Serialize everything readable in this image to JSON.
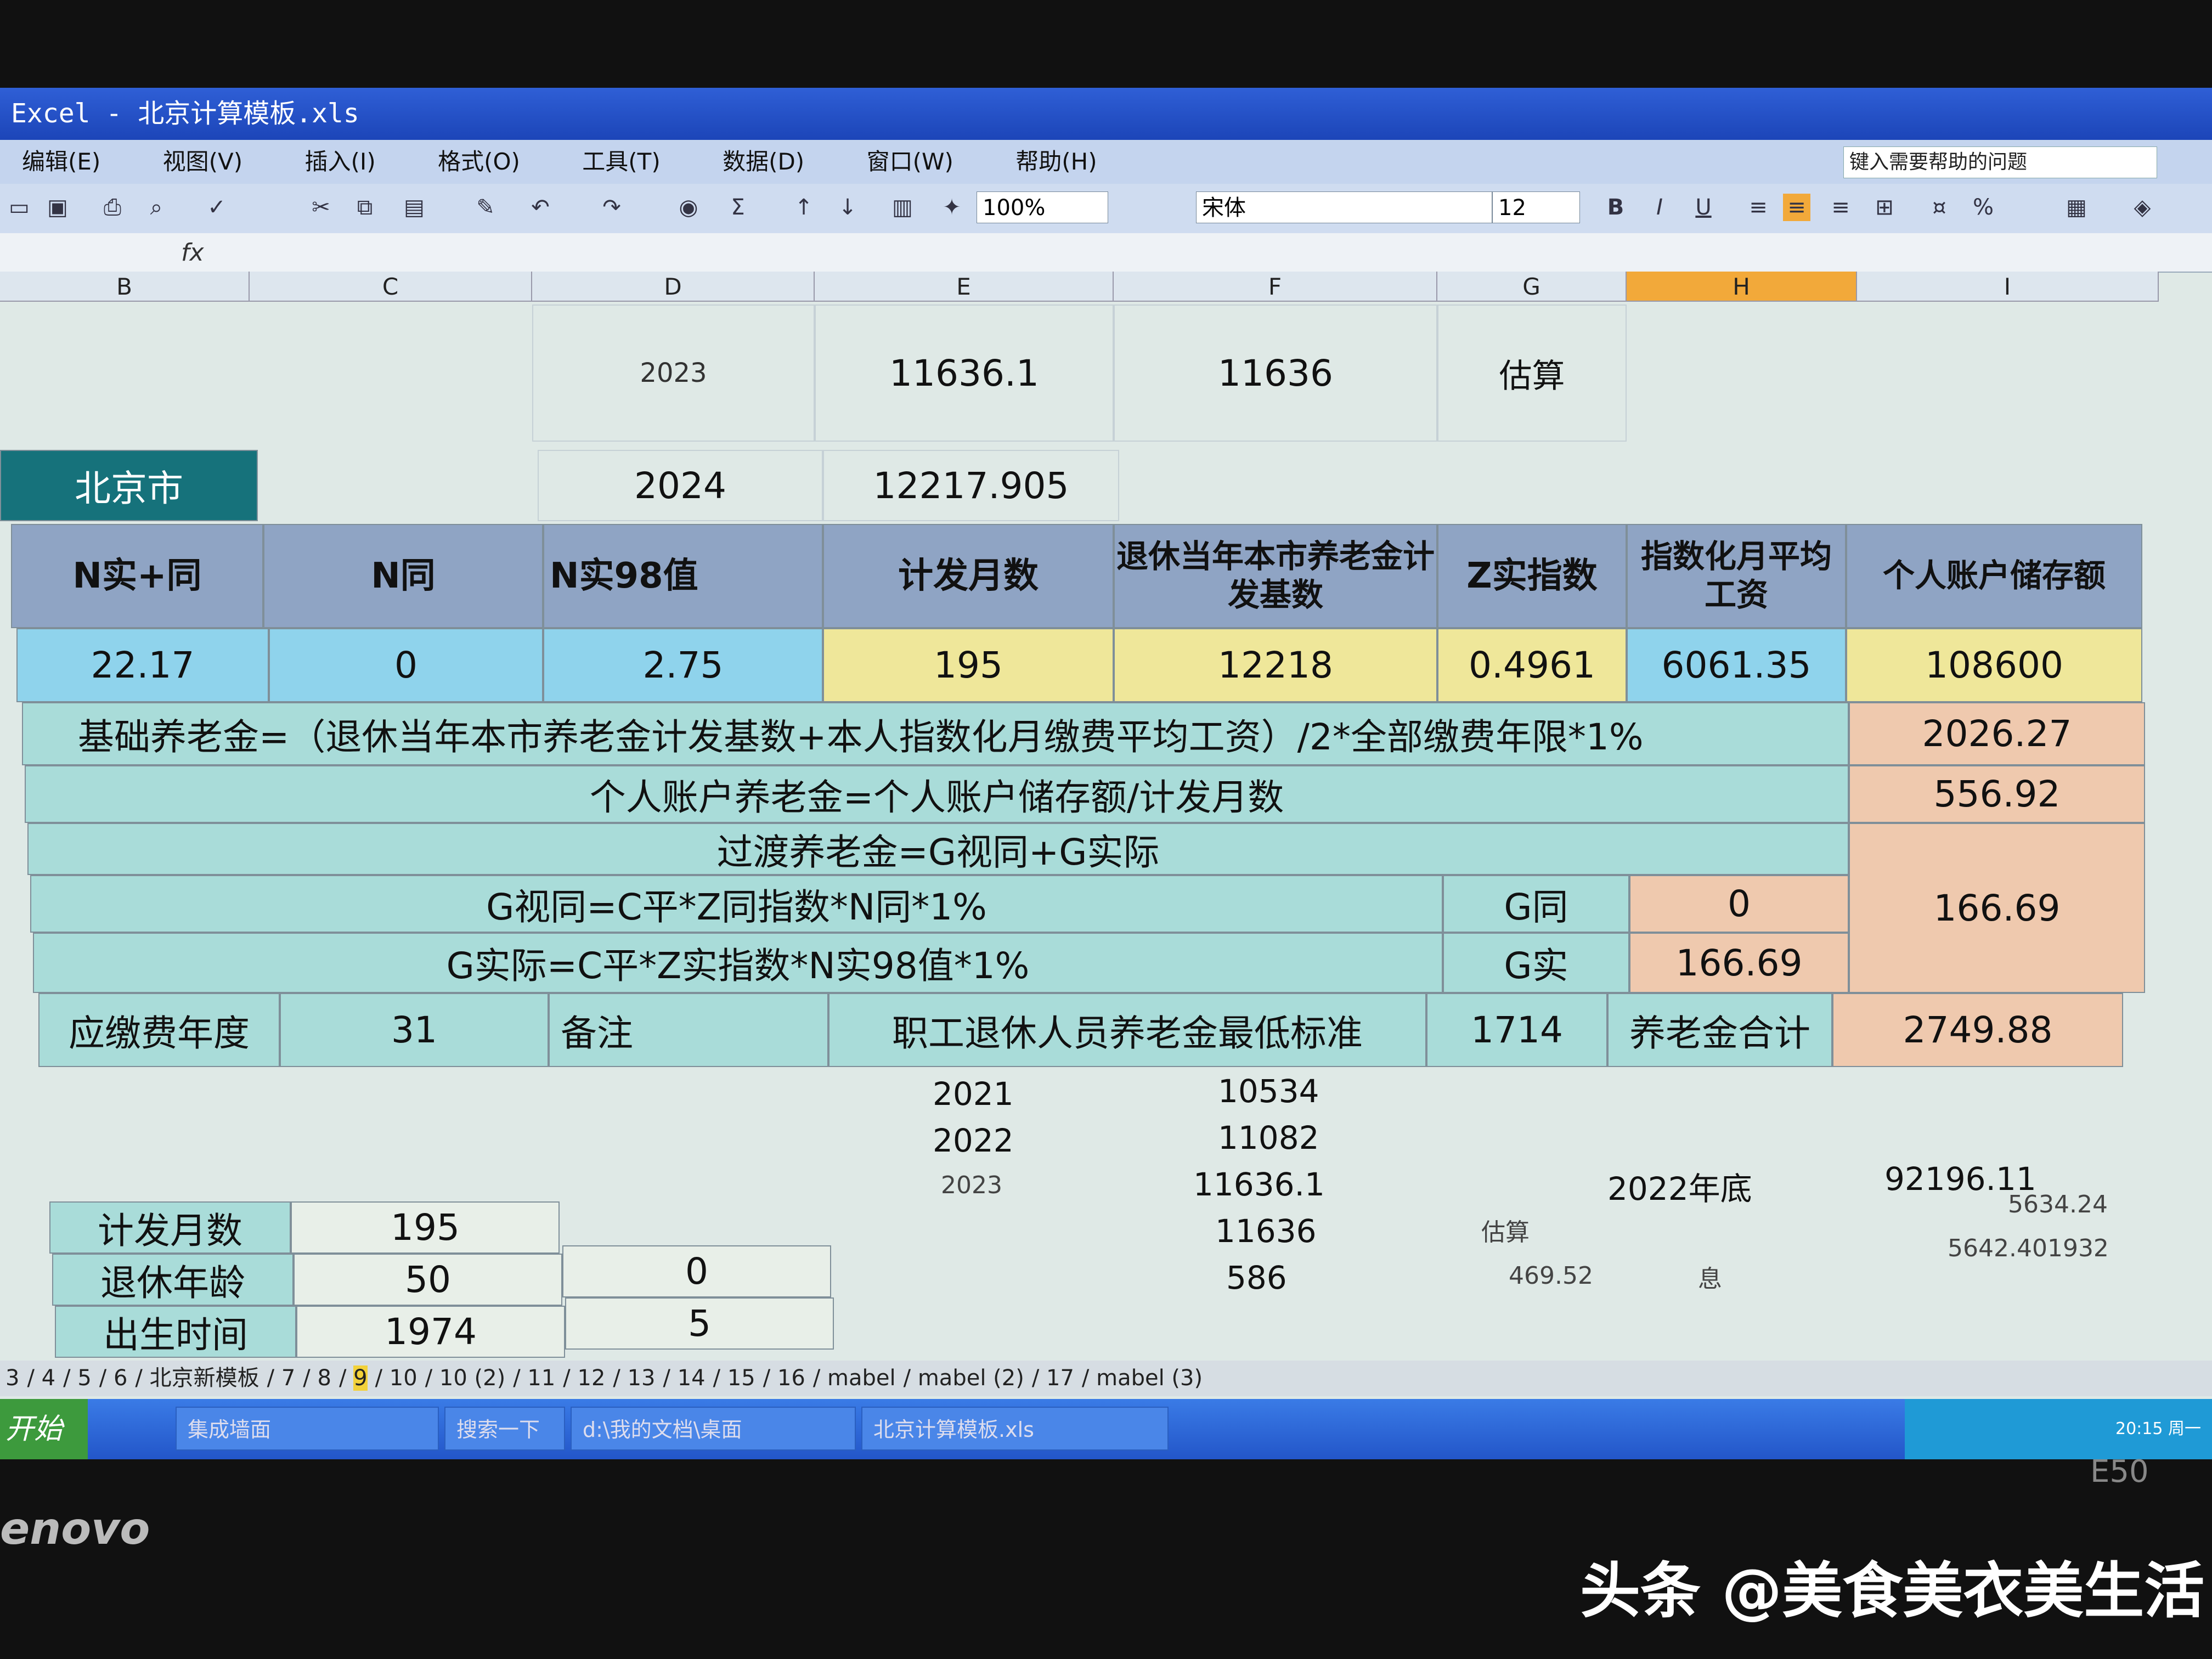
{
  "window": {
    "title": "Excel - 北京计算模板.xls"
  },
  "menu": [
    "编辑(E)",
    "视图(V)",
    "插入(I)",
    "格式(O)",
    "工具(T)",
    "数据(D)",
    "窗口(W)",
    "帮助(H)"
  ],
  "help_placeholder": "键入需要帮助的问题",
  "toolbar": {
    "zoom": "100%",
    "font": "宋体",
    "font_size": "12",
    "bold": "B",
    "italic": "I",
    "underline": "U",
    "percent": "%"
  },
  "formula_bar": {
    "fx": "fx"
  },
  "columns": [
    "B",
    "C",
    "D",
    "E",
    "F",
    "G",
    "H",
    "I"
  ],
  "row1": {
    "year": "2023",
    "e": "11636.1",
    "f": "11636",
    "g": "估算"
  },
  "row2": {
    "city": "北京市",
    "year": "2024",
    "e": "12217.905"
  },
  "headers": [
    "N实+同",
    "N同",
    "N实98值",
    "计发月数",
    "退休当年本市养老金计发基数",
    "Z实指数",
    "指数化月平均工资",
    "个人账户储存额"
  ],
  "values": [
    "22.17",
    "0",
    "2.75",
    "195",
    "12218",
    "0.4961",
    "6061.35",
    "108600"
  ],
  "formulas": {
    "basic": "基础养老金=（退休当年本市养老金计发基数+本人指数化月缴费平均工资）/2*全部缴费年限*1%",
    "basic_value": "2026.27",
    "personal": "个人账户养老金=个人账户储存额/计发月数",
    "personal_value": "556.92",
    "transition": "过渡养老金=G视同+G实际",
    "transition_value": "166.69",
    "g_tong": "G视同=C平*Z同指数*N同*1%",
    "g_tong_label": "G同",
    "g_tong_value": "0",
    "g_shi": "G实际=C平*Z实指数*N实98值*1%",
    "g_shi_label": "G实",
    "g_shi_value": "166.69"
  },
  "summary_row": {
    "label": "应缴费年度",
    "years": "31",
    "note": "备注",
    "min_label": "职工退休人员养老金最低标准",
    "min_value": "1714",
    "total_label": "养老金合计",
    "total_value": "2749.88"
  },
  "history": [
    {
      "year": "2021",
      "value": "10534"
    },
    {
      "year": "2022",
      "value": "11082"
    },
    {
      "year": "2023",
      "value": "11636.1"
    }
  ],
  "extra": {
    "v11636": "11636",
    "estimate": "估算",
    "v586": "586",
    "v469": "469.52",
    "xi": "息",
    "year_end": "2022年底",
    "year_end_value": "92196.11",
    "v5634": "5634.24",
    "v5642": "5642.401932"
  },
  "small_table": [
    {
      "label": "计发月数",
      "value": "195",
      "extra": ""
    },
    {
      "label": "退休年龄",
      "value": "50",
      "extra": "0"
    },
    {
      "label": "出生时间",
      "value": "1974",
      "extra": "5"
    }
  ],
  "sheet_tabs": [
    "3",
    "4",
    "5",
    "6",
    "北京新模板",
    "7",
    "8",
    "9",
    "10",
    "10 (2)",
    "11",
    "12",
    "13",
    "14",
    "15",
    "16",
    "mabel",
    "mabel (2)",
    "17",
    "mabel (3)"
  ],
  "active_tab": "9",
  "taskbar": {
    "start": "开始",
    "items": [
      "集成墙面",
      "搜索一下",
      "d:\\我的文档\\桌面",
      "北京计算模板.xls"
    ],
    "clock": "20:15 周一"
  },
  "laptop": {
    "brand": "enovo",
    "model": "E50"
  },
  "watermark": "头条 @美食美衣美生活",
  "colors": {
    "header": "#8fa4c4",
    "blue": "#8fd3ec",
    "yellow": "#efe79a",
    "peach": "#efc9ae",
    "teal": "#a9dcd9",
    "city": "#16727b",
    "active_col": "#f2a93a"
  }
}
